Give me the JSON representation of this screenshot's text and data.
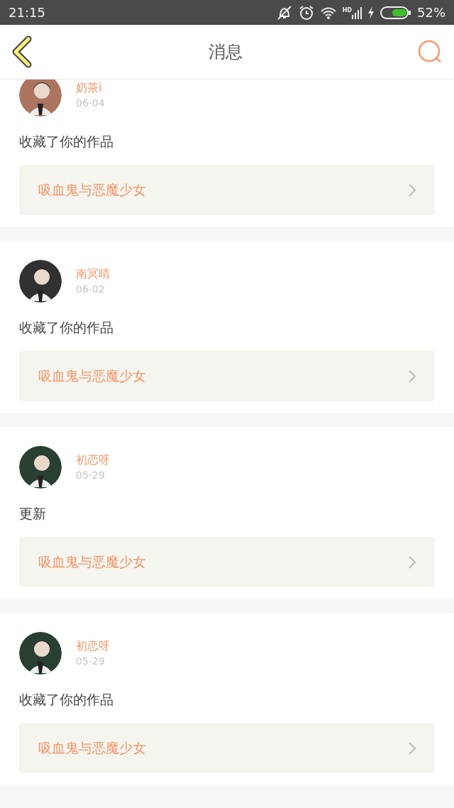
{
  "status_bar": {
    "time": "21:15",
    "signal_label": "HD",
    "battery": "52%"
  },
  "header": {
    "title": "消息"
  },
  "messages": [
    {
      "user": "奶茶i",
      "date": "06-04",
      "action": "收藏了你的作品",
      "work": "吸血鬼与恶魔少女"
    },
    {
      "user": "南冥晴",
      "date": "06-02",
      "action": "收藏了你的作品",
      "work": "吸血鬼与恶魔少女"
    },
    {
      "user": "初恋呀",
      "date": "05-29",
      "action": "更新",
      "work": "吸血鬼与恶魔少女"
    },
    {
      "user": "初恋呀",
      "date": "05-29",
      "action": "收藏了你的作品",
      "work": "吸血鬼与恶魔少女"
    }
  ]
}
